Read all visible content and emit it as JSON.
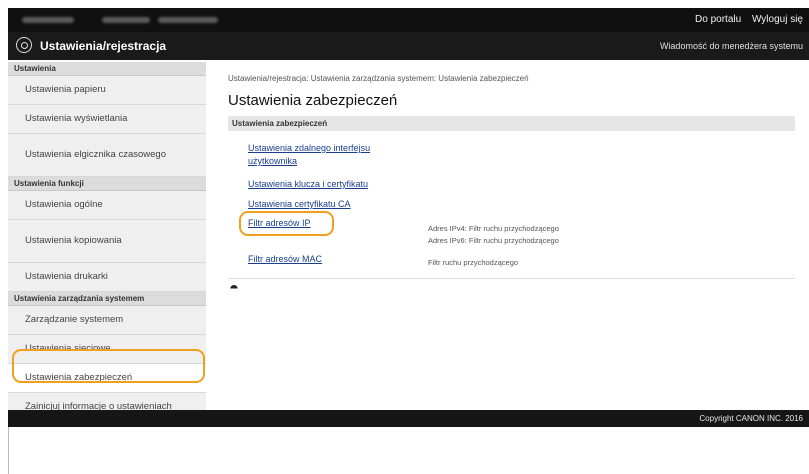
{
  "topbar": {
    "portal_link": "Do portalu",
    "logout_link": "Wyloguj się"
  },
  "titlebar": {
    "title": "Ustawienia/rejestracja",
    "message_link": "Wiadomość do menedżera systemu"
  },
  "sidebar": {
    "sections": [
      {
        "header": "Ustawienia",
        "items": [
          "Ustawienia papieru",
          "Ustawienia wyświetlania",
          "Ustawienia elgicznika czasowego"
        ]
      },
      {
        "header": "Ustawienia funkcji",
        "items": [
          "Ustawienia ogólne",
          "Ustawienia kopiowania",
          "Ustawienia drukarki"
        ]
      },
      {
        "header": "Ustawienia zarządzania systemem",
        "items": [
          "Zarządzanie systemem",
          "Ustawienia sieciowe",
          "Ustawienia zabezpieczeń",
          "Zainicjuj informacje o ustawieniach"
        ]
      }
    ]
  },
  "main": {
    "breadcrumb": "Ustawienia/rejestracja: Ustawienia zarządzania systemem: Ustawienia zabezpieczeń",
    "title": "Ustawienia zabezpieczeń",
    "section_header": "Ustawienia zabezpieczeń",
    "links": {
      "remote_ui_line1": "Ustawienia zdalnego interfejsu",
      "remote_ui_line2": "użytkownika",
      "key_cert": "Ustawienia klucza i certyfikatu",
      "ca_cert": "Ustawienia certyfikatu CA",
      "ip_filter": "Filtr adresów IP",
      "mac_filter": "Filtr adresów MAC"
    },
    "descriptions": {
      "ipv4": "Adres IPv4: Filtr ruchu przychodzącego",
      "ipv6": "Adres IPv6: Filtr ruchu przychodzącego",
      "mac": "Filtr ruchu przychodzącego"
    },
    "to_top": "⯊"
  },
  "footer": {
    "copyright": "Copyright CANON INC. 2016"
  },
  "colors": {
    "highlight": "#f0a020",
    "link": "#1a3e8c",
    "header_bg": "#1a1a1a"
  }
}
